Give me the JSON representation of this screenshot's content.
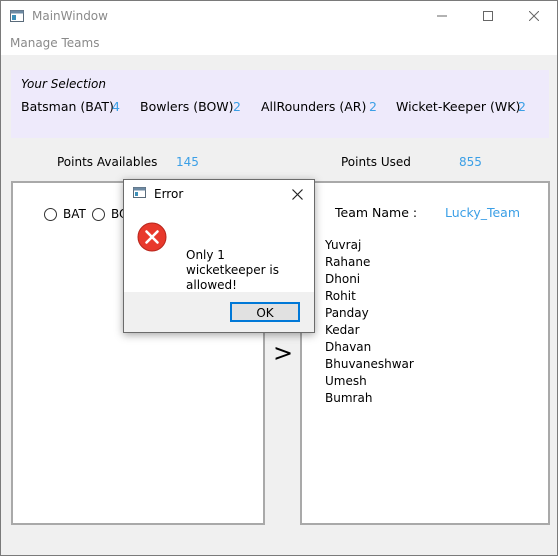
{
  "window": {
    "title": "MainWindow",
    "app_icon": "window-app-icon",
    "controls": [
      "minimize-icon",
      "maximize-icon",
      "close-icon"
    ]
  },
  "menu": {
    "items": [
      "Manage Teams"
    ]
  },
  "selection": {
    "heading": "Your Selection",
    "counts": [
      {
        "label": "Batsman (BAT)",
        "value": "4"
      },
      {
        "label": "Bowlers (BOW)",
        "value": "2"
      },
      {
        "label": "AllRounders (AR)",
        "value": "2"
      },
      {
        "label": "Wicket-Keeper (WK)",
        "value": "2"
      }
    ]
  },
  "points": {
    "available_label": "Points Availables",
    "available_value": "145",
    "used_label": "Points Used",
    "used_value": "855"
  },
  "left_panel": {
    "radios": [
      {
        "label": "BAT"
      },
      {
        "label": "BO"
      }
    ]
  },
  "transfer_button": {
    "label": ">"
  },
  "right_panel": {
    "team_name_label": "Team Name  :",
    "team_name_value": "Lucky_Team",
    "players": [
      "Yuvraj",
      "Rahane",
      "Dhoni",
      "Rohit",
      "Panday",
      "Kedar",
      "Dhavan",
      "Bhuvaneshwar",
      "Umesh",
      "Bumrah"
    ]
  },
  "dialog": {
    "title": "Error",
    "icon": "error-icon",
    "message": "Only 1 wicketkeeper is allowed!",
    "ok_label": "OK"
  },
  "colors": {
    "accent": "#3b9fe6",
    "selection_bg": "#eeeafb",
    "error_red": "#e8392c",
    "focus_border": "#0078d7"
  }
}
